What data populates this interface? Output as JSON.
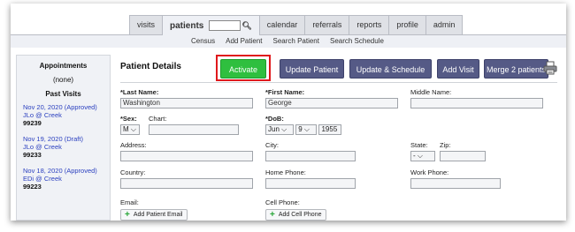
{
  "tabs": [
    {
      "label": "visits",
      "active": false
    },
    {
      "label": "patients",
      "active": true
    },
    {
      "label": "calendar",
      "active": false
    },
    {
      "label": "referrals",
      "active": false
    },
    {
      "label": "reports",
      "active": false
    },
    {
      "label": "profile",
      "active": false
    },
    {
      "label": "admin",
      "active": false
    }
  ],
  "subnav": [
    "Census",
    "Add Patient",
    "Search Patient",
    "Search Schedule"
  ],
  "sidebar": {
    "appointments_title": "Appointments",
    "appointments_none": "(none)",
    "past_visits_title": "Past Visits",
    "visits": [
      {
        "line1": "Nov 20, 2020 (Approved)",
        "line2": "JLo @ Creek",
        "id": "99239"
      },
      {
        "line1": "Nov 19, 2020 (Draft)",
        "line2": "JLo @ Creek",
        "id": "99233"
      },
      {
        "line1": "Nov 18, 2020 (Approved)",
        "line2": "EDi @ Creek",
        "id": "99223"
      }
    ]
  },
  "main": {
    "title": "Patient Details",
    "buttons": {
      "activate": "Activate",
      "update_patient": "Update Patient",
      "update_schedule": "Update & Schedule",
      "add_visit": "Add Visit",
      "merge": "Merge 2 patients"
    },
    "fields": {
      "last_name": {
        "label": "*Last Name:",
        "value": "Washington"
      },
      "first_name": {
        "label": "*First Name:",
        "value": "George"
      },
      "middle_name": {
        "label": "Middle Name:",
        "value": ""
      },
      "sex": {
        "label": "*Sex:",
        "value": "M"
      },
      "chart": {
        "label": "Chart:",
        "value": ""
      },
      "dob": {
        "label": "*DoB:",
        "month": "Jun",
        "day": "9",
        "year": "1955"
      },
      "address": {
        "label": "Address:",
        "value": ""
      },
      "city": {
        "label": "City:",
        "value": ""
      },
      "state": {
        "label": "State:",
        "value": "-"
      },
      "zip": {
        "label": "Zip:",
        "value": ""
      },
      "country": {
        "label": "Country:",
        "value": ""
      },
      "home_phone": {
        "label": "Home Phone:",
        "value": ""
      },
      "work_phone": {
        "label": "Work Phone:",
        "value": ""
      },
      "email": {
        "label": "Email:",
        "button": "Add Patient Email"
      },
      "cell_phone": {
        "label": "Cell Phone:",
        "button": "Add Cell Phone"
      }
    }
  },
  "colors": {
    "accent_button": "#555a86",
    "activate_button": "#2fbf3f",
    "highlight_box": "#e0181c",
    "link": "#2a3fbf"
  }
}
